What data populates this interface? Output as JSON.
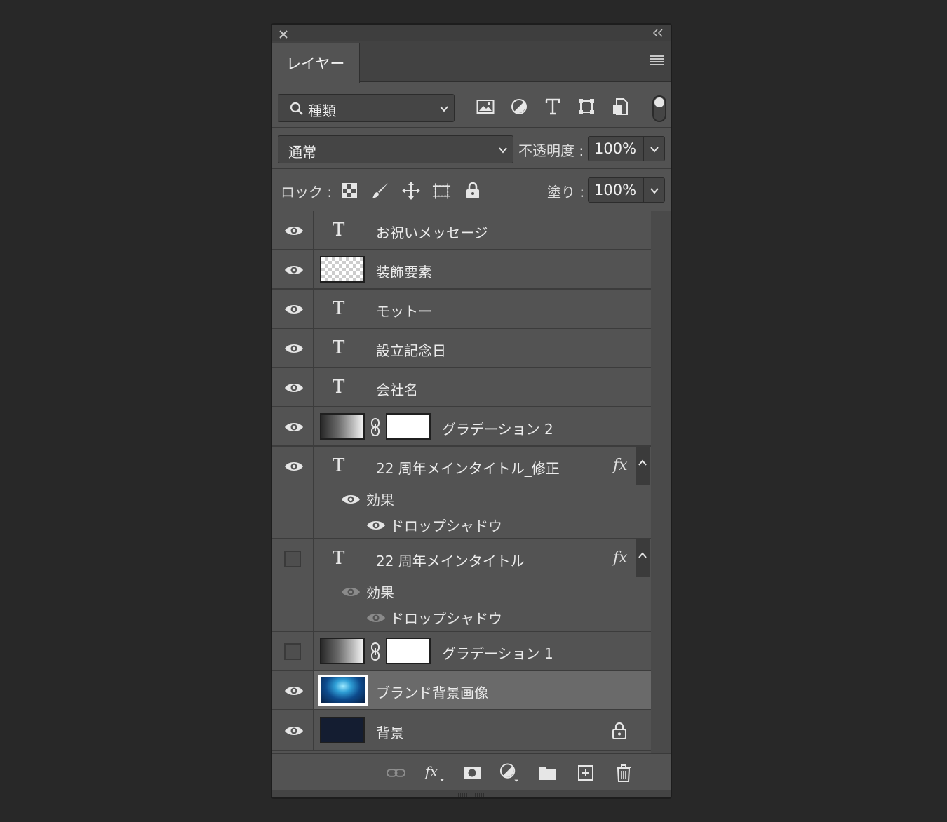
{
  "panel": {
    "tab_title": "レイヤー",
    "filter": {
      "kind_label": "種類"
    },
    "blend": {
      "mode": "通常",
      "opacity_label": "不透明度 :",
      "opacity": "100%"
    },
    "lock": {
      "label": "ロック :",
      "fill_label": "塗り :",
      "fill": "100%"
    }
  },
  "layers": [
    {
      "name": "お祝いメッセージ",
      "type": "text",
      "visible": true
    },
    {
      "name": "装飾要素",
      "type": "pixel",
      "visible": true
    },
    {
      "name": "モットー",
      "type": "text",
      "visible": true
    },
    {
      "name": "設立記念日",
      "type": "text",
      "visible": true
    },
    {
      "name": "会社名",
      "type": "text",
      "visible": true
    },
    {
      "name": "グラデーション 2",
      "type": "gradient",
      "visible": true
    },
    {
      "name": "22 周年メインタイトル_修正",
      "type": "text",
      "visible": true,
      "fx": "fx",
      "effects_label": "効果",
      "effect": "ドロップシャドウ"
    },
    {
      "name": "22 周年メインタイトル",
      "type": "text",
      "visible": false,
      "fx": "fx",
      "effects_label": "効果",
      "effect": "ドロップシャドウ"
    },
    {
      "name": "グラデーション 1",
      "type": "gradient",
      "visible": false
    },
    {
      "name": "ブランド背景画像",
      "type": "image",
      "visible": true,
      "selected": true
    },
    {
      "name": "背景",
      "type": "background",
      "visible": true,
      "locked": true
    }
  ],
  "icons": {
    "close": "close-icon",
    "collapse": "collapse-icon",
    "menu": "panel-menu-icon",
    "search": "search-icon",
    "filter": [
      "image-filter-icon",
      "adjustment-filter-icon",
      "type-filter-icon",
      "shape-filter-icon",
      "smart-object-filter-icon"
    ],
    "lock": [
      "lock-transparent-icon",
      "lock-image-icon",
      "lock-position-icon",
      "lock-artboard-icon",
      "lock-all-icon"
    ],
    "footer": [
      "link-layers-icon",
      "fx-icon",
      "mask-icon",
      "new-adjustment-icon",
      "new-group-icon",
      "new-layer-icon",
      "delete-icon"
    ]
  },
  "colors": {
    "panel_bg": "#535353",
    "app_bg": "#282828",
    "selected_row": "#6a6a6a"
  }
}
